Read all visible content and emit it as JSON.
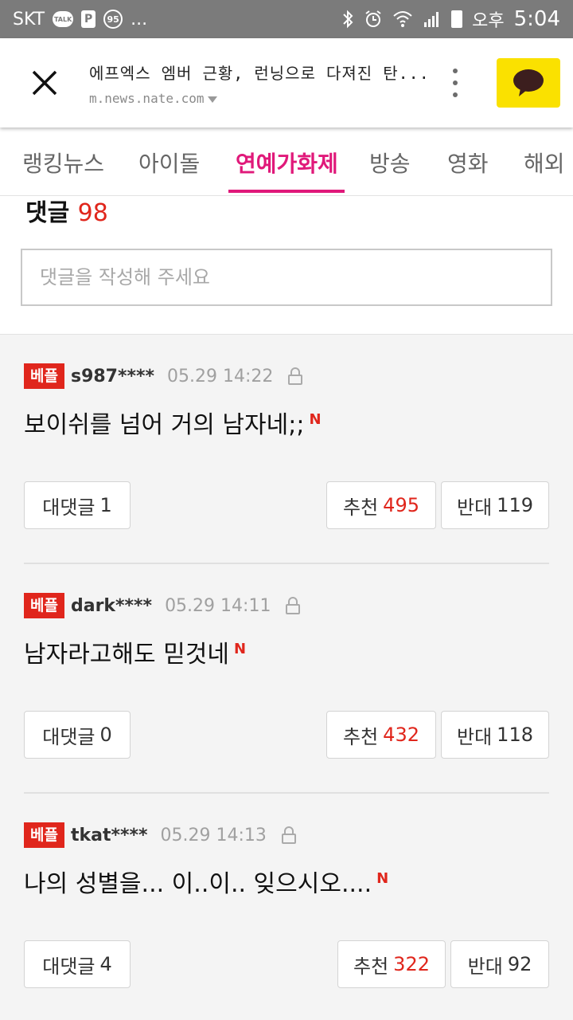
{
  "status_bar": {
    "carrier": "SKT",
    "talk_label": "TALK",
    "p_label": "P",
    "badge_95": "95",
    "more": "...",
    "ampm": "오후",
    "time": "5:04"
  },
  "browser": {
    "page_title": "에프엑스 엠버 근황, 런닝으로 다져진 탄...",
    "url": "m.news.nate.com"
  },
  "tabs": [
    {
      "label": "랭킹뉴스",
      "active": false
    },
    {
      "label": "아이돌",
      "active": false
    },
    {
      "label": "연예가화제",
      "active": true
    },
    {
      "label": "방송",
      "active": false
    },
    {
      "label": "영화",
      "active": false
    },
    {
      "label": "해외",
      "active": false
    }
  ],
  "comments_section": {
    "heading": "댓글",
    "count": "98",
    "input_placeholder": "댓글을 작성해 주세요"
  },
  "comments": [
    {
      "badge": "베플",
      "user": "s987****",
      "time": "05.29 14:22",
      "text": "보이쉬를 넘어 거의 남자네;;",
      "new_mark": "N",
      "reply_label": "대댓글",
      "reply_count": "1",
      "like_label": "추천",
      "like_count": "495",
      "dislike_label": "반대",
      "dislike_count": "119"
    },
    {
      "badge": "베플",
      "user": "dark****",
      "time": "05.29 14:11",
      "text": "남자라고해도 믿것네",
      "new_mark": "N",
      "reply_label": "대댓글",
      "reply_count": "0",
      "like_label": "추천",
      "like_count": "432",
      "dislike_label": "반대",
      "dislike_count": "118"
    },
    {
      "badge": "베플",
      "user": "tkat****",
      "time": "05.29 14:13",
      "text": "나의 성별을... 이..이.. 잊으시오....",
      "new_mark": "N",
      "reply_label": "대댓글",
      "reply_count": "4",
      "like_label": "추천",
      "like_count": "322",
      "dislike_label": "반대",
      "dislike_count": "92"
    }
  ],
  "colors": {
    "accent": "#e0197a",
    "badge_red": "#e0261c",
    "kakao_yellow": "#fae100",
    "status_bar": "#7b7b7b"
  },
  "icons": [
    "kakaotalk-icon",
    "bluetooth-icon",
    "alarm-icon",
    "wifi-icon",
    "signal-icon",
    "battery-icon",
    "close-icon",
    "more-vert-icon",
    "kakao-share-icon",
    "lock-icon"
  ]
}
